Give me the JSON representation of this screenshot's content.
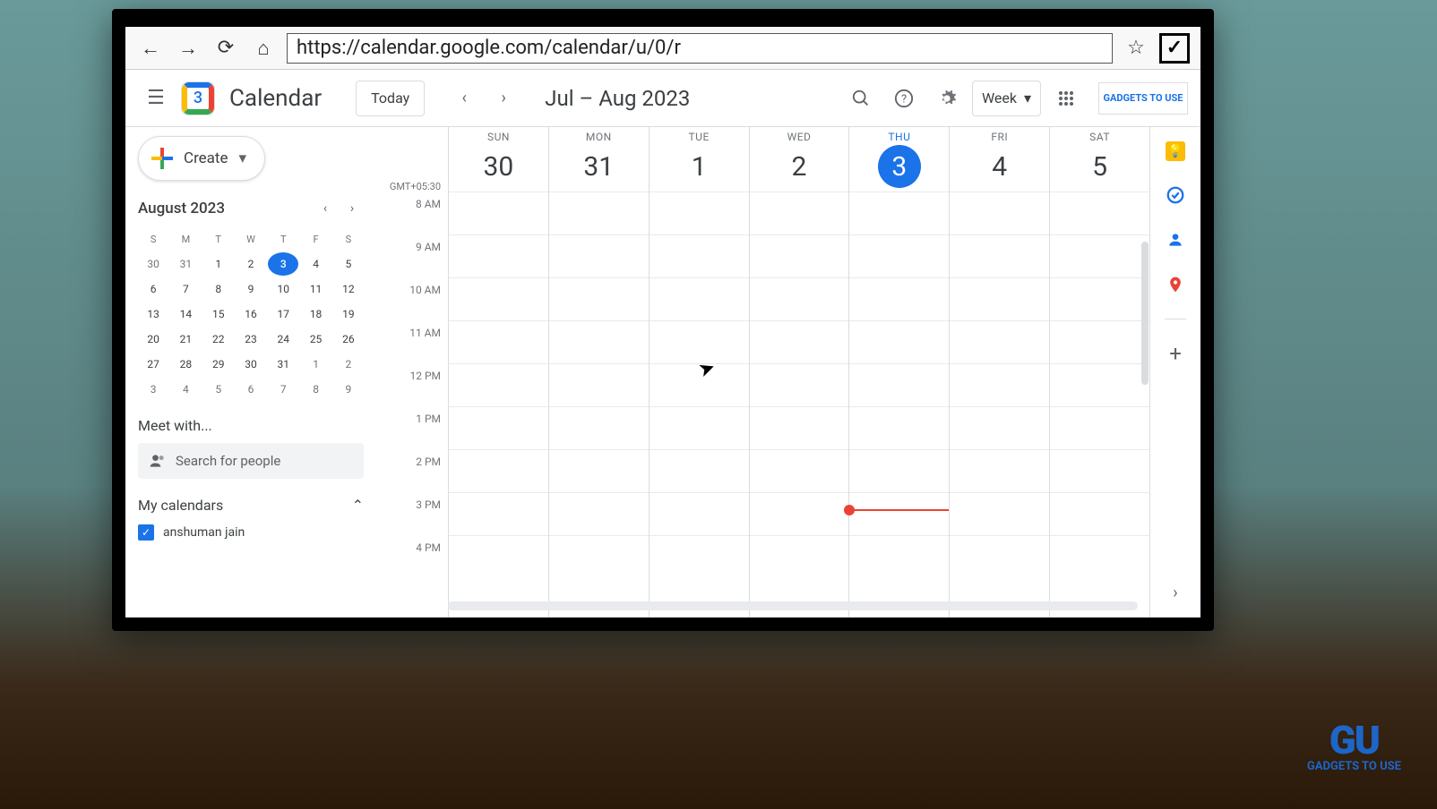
{
  "browser": {
    "url": "https://calendar.google.com/calendar/u/0/r"
  },
  "header": {
    "logo_day": "3",
    "app_name": "Calendar",
    "today_label": "Today",
    "date_range": "Jul – Aug 2023",
    "view_label": "Week"
  },
  "sidebar": {
    "create_label": "Create",
    "mini_month": "August 2023",
    "dow": [
      "S",
      "M",
      "T",
      "W",
      "T",
      "F",
      "S"
    ],
    "weeks": [
      [
        {
          "n": "30",
          "m": true
        },
        {
          "n": "31",
          "m": true
        },
        {
          "n": "1"
        },
        {
          "n": "2"
        },
        {
          "n": "3",
          "today": true
        },
        {
          "n": "4"
        },
        {
          "n": "5"
        }
      ],
      [
        {
          "n": "6"
        },
        {
          "n": "7"
        },
        {
          "n": "8"
        },
        {
          "n": "9"
        },
        {
          "n": "10"
        },
        {
          "n": "11"
        },
        {
          "n": "12"
        }
      ],
      [
        {
          "n": "13"
        },
        {
          "n": "14"
        },
        {
          "n": "15"
        },
        {
          "n": "16"
        },
        {
          "n": "17"
        },
        {
          "n": "18"
        },
        {
          "n": "19"
        }
      ],
      [
        {
          "n": "20"
        },
        {
          "n": "21"
        },
        {
          "n": "22"
        },
        {
          "n": "23"
        },
        {
          "n": "24"
        },
        {
          "n": "25"
        },
        {
          "n": "26"
        }
      ],
      [
        {
          "n": "27"
        },
        {
          "n": "28"
        },
        {
          "n": "29"
        },
        {
          "n": "30"
        },
        {
          "n": "31"
        },
        {
          "n": "1",
          "m": true
        },
        {
          "n": "2",
          "m": true
        }
      ],
      [
        {
          "n": "3",
          "m": true
        },
        {
          "n": "4",
          "m": true
        },
        {
          "n": "5",
          "m": true
        },
        {
          "n": "6",
          "m": true
        },
        {
          "n": "7",
          "m": true
        },
        {
          "n": "8",
          "m": true
        },
        {
          "n": "9",
          "m": true
        }
      ]
    ],
    "meet_label": "Meet with...",
    "search_placeholder": "Search for people",
    "my_calendars_label": "My calendars",
    "cal_item_0": "anshuman jain"
  },
  "grid": {
    "timezone": "GMT+05:30",
    "hours": [
      "8 AM",
      "9 AM",
      "10 AM",
      "11 AM",
      "12 PM",
      "1 PM",
      "2 PM",
      "3 PM",
      "4 PM"
    ],
    "days": [
      {
        "dow": "SUN",
        "num": "30"
      },
      {
        "dow": "MON",
        "num": "31"
      },
      {
        "dow": "TUE",
        "num": "1"
      },
      {
        "dow": "WED",
        "num": "2"
      },
      {
        "dow": "THU",
        "num": "3",
        "today": true
      },
      {
        "dow": "FRI",
        "num": "4"
      },
      {
        "dow": "SAT",
        "num": "5"
      }
    ],
    "now_hour_offset": 7.4,
    "now_day_index": 4
  },
  "brand": "GADGETS TO USE"
}
